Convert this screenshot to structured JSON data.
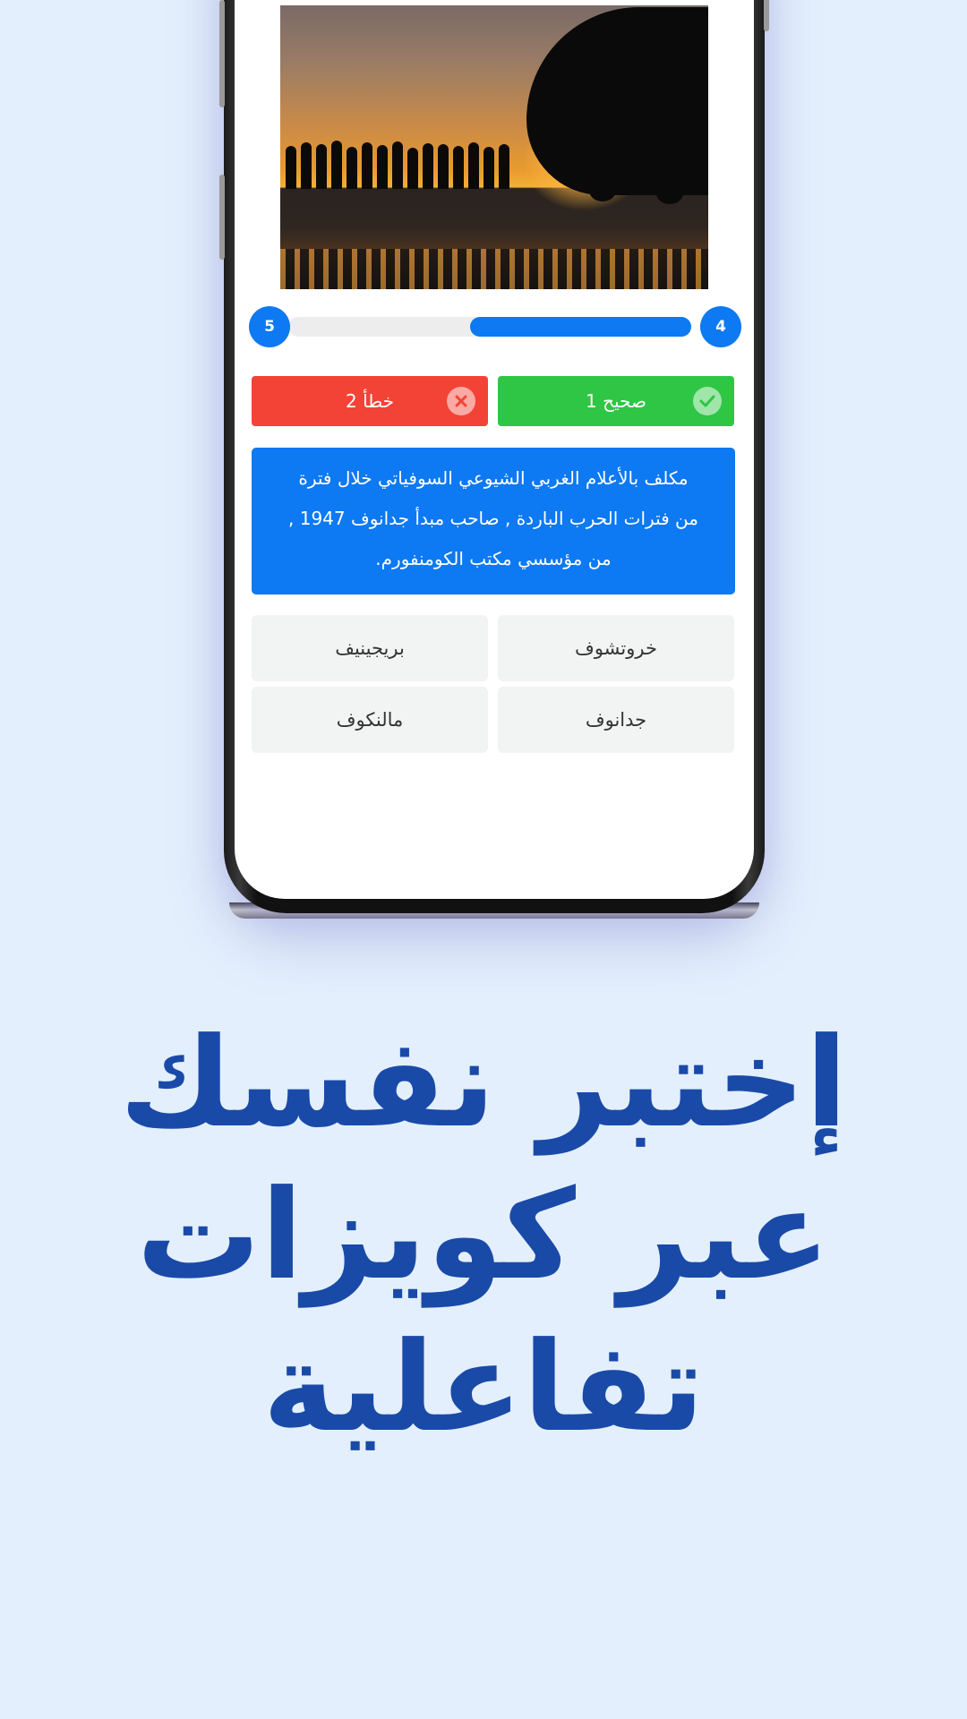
{
  "quiz": {
    "progress": {
      "current": "4",
      "total": "5",
      "fraction": 0.55,
      "color": "#0d79f2"
    },
    "scores": {
      "correct_label": "1 صحيح",
      "wrong_label": "2 خطأ",
      "correct_color": "#2ec644",
      "wrong_color": "#f34336",
      "correct_icon": "check-circle-icon",
      "wrong_icon": "x-circle-icon"
    },
    "question": {
      "lines": [
        "مكلف بالأعلام الغربي الشيوعي السوفياتي خلال فترة",
        "من فترات الحرب الباردة , صاحب مبدأ جدانوف 1947 ,",
        "من مؤسسي مكتب الكومنفورم."
      ]
    },
    "answers": [
      "خروتشوف",
      "بريجينيف",
      "جدانوف",
      "مالنكوف"
    ]
  },
  "headline": {
    "lines": [
      "إختبر نفسك",
      "عبر كويزات",
      "تفاعلية"
    ],
    "color": "#1a4aa8"
  }
}
